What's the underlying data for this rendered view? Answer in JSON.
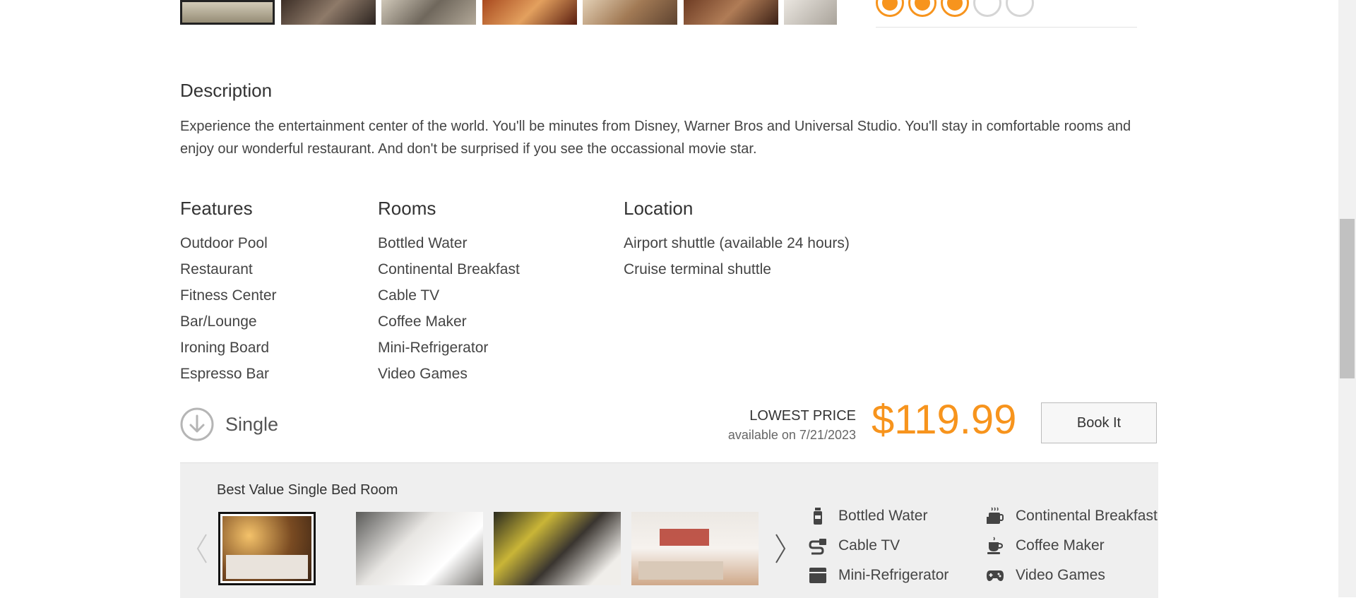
{
  "gallery": {
    "thumbs": [
      "lobby",
      "living-room",
      "bar",
      "restaurant",
      "lounge",
      "dining",
      "room"
    ],
    "thumb_colors": [
      "#b9ad94",
      "#5c4a3e",
      "#9a8e7c",
      "#8a3b20",
      "#c8a27a",
      "#8c5a3c",
      "#d6d0c8"
    ]
  },
  "rating": {
    "value": 3,
    "max": 5
  },
  "description": {
    "heading": "Description",
    "text": "Experience the entertainment center of the world. You'll be minutes from Disney, Warner Bros and Universal Studio. You'll stay in comfortable rooms and enjoy our wonderful restaurant. And don't be surprised if you see the occassional movie star."
  },
  "features": {
    "heading": "Features",
    "items": [
      "Outdoor Pool",
      "Restaurant",
      "Fitness Center",
      "Bar/Lounge",
      "Ironing Board",
      "Espresso Bar"
    ]
  },
  "rooms": {
    "heading": "Rooms",
    "items": [
      "Bottled Water",
      "Continental Breakfast",
      "Cable TV",
      "Coffee Maker",
      "Mini-Refrigerator",
      "Video Games"
    ]
  },
  "location": {
    "heading": "Location",
    "items": [
      "Airport shuttle (available 24 hours)",
      "Cruise terminal shuttle"
    ]
  },
  "room_type": {
    "label": "Single",
    "icon": "down-arrow-circle-icon"
  },
  "price": {
    "lowest_label": "LOWEST PRICE",
    "available_text": "available on 7/21/2023",
    "amount": "$119.99",
    "accent": "#f7941d"
  },
  "book_button": {
    "label": "Book It"
  },
  "room_panel": {
    "title": "Best Value Single Bed Room",
    "photos": [
      "bedroom-warm",
      "bedroom-white",
      "bedroom-dark",
      "bedroom-red-art"
    ],
    "prev_icon": "chevron-left-icon",
    "next_icon": "chevron-right-icon",
    "amenities": [
      {
        "label": "Bottled Water",
        "icon": "bottle-icon"
      },
      {
        "label": "Continental Breakfast",
        "icon": "breakfast-icon"
      },
      {
        "label": "Cable TV",
        "icon": "cable-icon"
      },
      {
        "label": "Coffee Maker",
        "icon": "coffee-cup-icon"
      },
      {
        "label": "Mini-Refrigerator",
        "icon": "fridge-icon"
      },
      {
        "label": "Video Games",
        "icon": "gamepad-icon"
      }
    ]
  }
}
